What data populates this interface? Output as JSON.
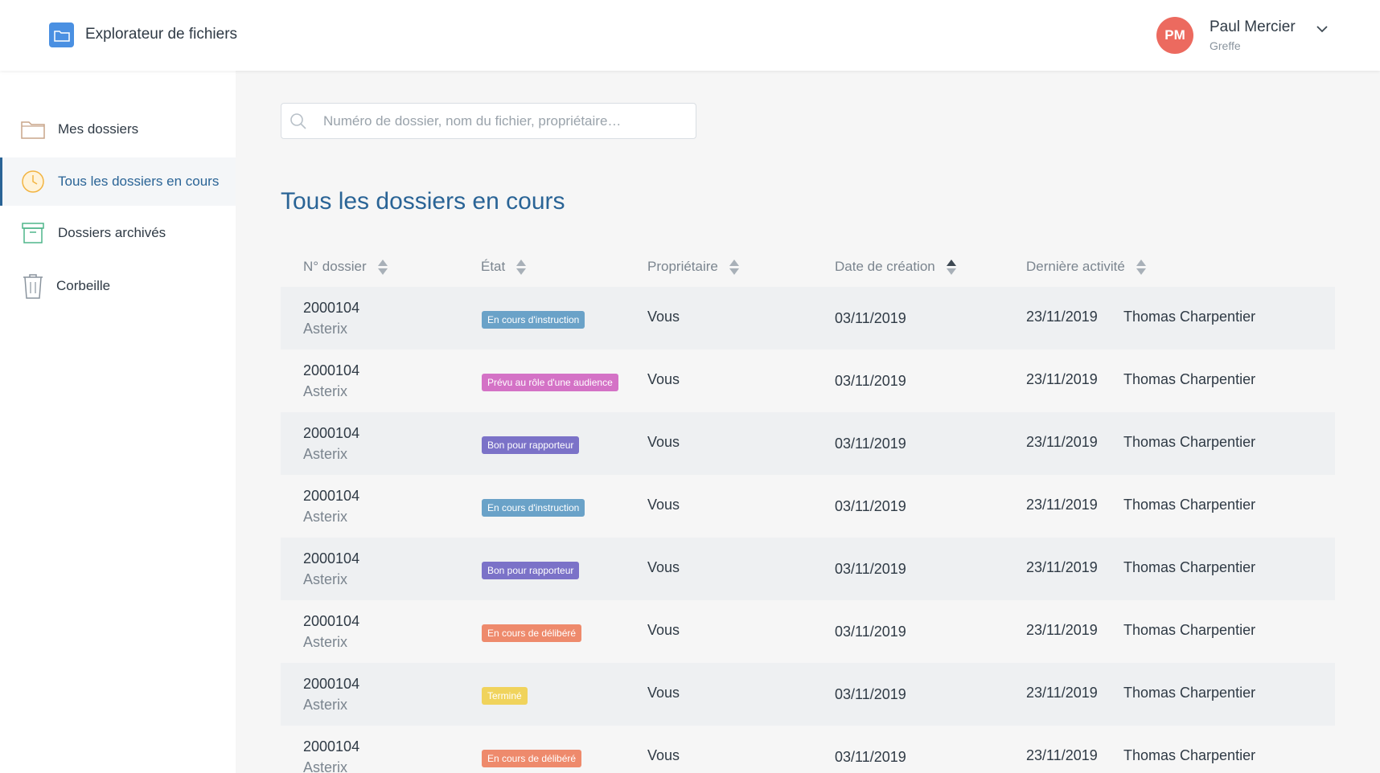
{
  "app": {
    "title": "Explorateur de fichiers",
    "logo_icon": "folder-icon",
    "accent": "#4a90e2"
  },
  "user": {
    "initials": "PM",
    "name": "Paul Mercier",
    "role": "Greffe",
    "avatar_color": "#ec6a5f"
  },
  "sidebar": {
    "items": [
      {
        "label": "Mes dossiers",
        "icon": "folder-outline-icon",
        "active": false
      },
      {
        "label": "Tous les dossiers en cours",
        "icon": "clock-icon",
        "active": true
      },
      {
        "label": "Dossiers archivés",
        "icon": "archive-box-icon",
        "active": false
      },
      {
        "label": "Corbeille",
        "icon": "trash-icon",
        "active": false
      }
    ]
  },
  "search": {
    "placeholder": "Numéro de dossier, nom du fichier, propriétaire…",
    "value": ""
  },
  "main": {
    "title": "Tous les dossiers en cours",
    "columns": [
      {
        "label": "N° dossier",
        "sort": "none"
      },
      {
        "label": "État",
        "sort": "none"
      },
      {
        "label": "Propriétaire",
        "sort": "none"
      },
      {
        "label": "Date de création",
        "sort": "asc"
      },
      {
        "label": "Dernière activité",
        "sort": "none"
      }
    ],
    "rows": [
      {
        "number": "2000104",
        "name": "Asterix",
        "state": "En cours d'instruction",
        "state_color": "#6aa2c8",
        "owner": "Vous",
        "created": "03/11/2019",
        "last_activity": "23/11/2019",
        "last_user": "Thomas Charpentier"
      },
      {
        "number": "2000104",
        "name": "Asterix",
        "state": "Prévu au rôle d'une audience",
        "state_color": "#d472c6",
        "owner": "Vous",
        "created": "03/11/2019",
        "last_activity": "23/11/2019",
        "last_user": "Thomas Charpentier"
      },
      {
        "number": "2000104",
        "name": "Asterix",
        "state": "Bon pour rapporteur",
        "state_color": "#7b72c8",
        "owner": "Vous",
        "created": "03/11/2019",
        "last_activity": "23/11/2019",
        "last_user": "Thomas Charpentier"
      },
      {
        "number": "2000104",
        "name": "Asterix",
        "state": "En cours d'instruction",
        "state_color": "#6aa2c8",
        "owner": "Vous",
        "created": "03/11/2019",
        "last_activity": "23/11/2019",
        "last_user": "Thomas Charpentier"
      },
      {
        "number": "2000104",
        "name": "Asterix",
        "state": "Bon pour rapporteur",
        "state_color": "#7b72c8",
        "owner": "Vous",
        "created": "03/11/2019",
        "last_activity": "23/11/2019",
        "last_user": "Thomas Charpentier"
      },
      {
        "number": "2000104",
        "name": "Asterix",
        "state": "En cours de délibéré",
        "state_color": "#ee8a6c",
        "owner": "Vous",
        "created": "03/11/2019",
        "last_activity": "23/11/2019",
        "last_user": "Thomas Charpentier"
      },
      {
        "number": "2000104",
        "name": "Asterix",
        "state": "Terminé",
        "state_color": "#f0d35c",
        "owner": "Vous",
        "created": "03/11/2019",
        "last_activity": "23/11/2019",
        "last_user": "Thomas Charpentier"
      },
      {
        "number": "2000104",
        "name": "Asterix",
        "state": "En cours de délibéré",
        "state_color": "#ee8a6c",
        "owner": "Vous",
        "created": "03/11/2019",
        "last_activity": "23/11/2019",
        "last_user": "Thomas Charpentier"
      }
    ]
  }
}
